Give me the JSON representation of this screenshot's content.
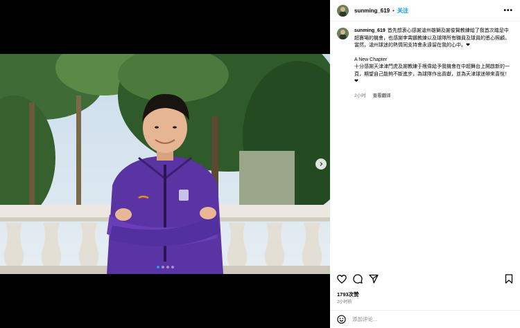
{
  "post": {
    "username": "sunming_619",
    "separator": "•",
    "follow_label": "关注",
    "more_label": "•••",
    "caption_username": "sunming_619",
    "caption_p1": "首先想衷心感謝滄州雄獅及謝俊賢教練給了我首次踏足中超賽場的機會，也感謝李霄鵬教練以及球隊所有職員及球員的悉心照顧。當然，滄州球迷的熱情同支持會永遠留在我的心中。❤",
    "chapter_title": "A New Chapter",
    "caption_p2": "十分感謝天津津門虎及謝教練于根偉給予我機會在中超舞台上開啟新的一頁，期望自己能夠不斷進步，為球隊作出貢獻，並為天津球迷帶來喜悅！❤",
    "caption_time": "2小时",
    "see_translation": "查看翻译",
    "likes": "1793次赞",
    "posted_ago": "2小时前",
    "comment_placeholder": "添加评论...",
    "carousel_count": 4,
    "carousel_active": 1
  },
  "icons": {
    "like": "heart-icon",
    "comment": "comment-icon",
    "share": "send-icon",
    "save": "bookmark-icon",
    "emoji": "smiley-icon",
    "next": "chevron-right-icon"
  },
  "colors": {
    "follow": "#0095f6",
    "jersey": "#5b34a3",
    "sky": "#bcd3e6",
    "active_dot": "#1d9bf0"
  }
}
